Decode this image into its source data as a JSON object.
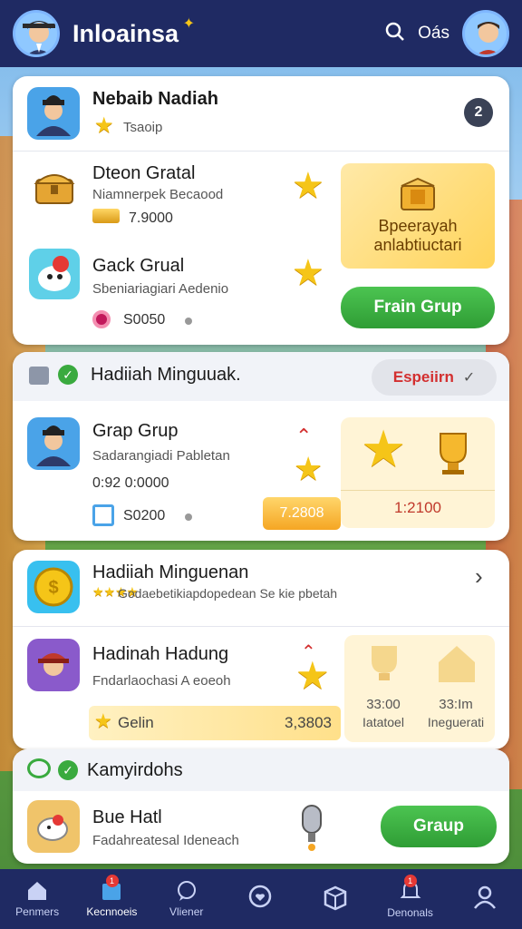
{
  "app": {
    "title": "Inloainsa",
    "top_label": "Oás"
  },
  "card1": {
    "header": {
      "title": "Nebaib Nadiah",
      "subtitle": "Tsaoip",
      "badge": "2"
    },
    "item1": {
      "title": "Dteon Gratal",
      "subtitle": "Niamnerpek Becaood",
      "value": "7.9000"
    },
    "item2": {
      "title": "Gack Grual",
      "subtitle": "Sbeniariagiari Aedenio",
      "value": "S0050"
    },
    "promo_line1": "Bpeerayah",
    "promo_line2": "anlabtiuctari",
    "button": "Frain Grup"
  },
  "card2": {
    "header": {
      "title": "Hadiiah Minguuak.",
      "dropdown": "Espeiirn"
    },
    "item": {
      "title": "Grap Grup",
      "subtitle": "Sadarangiadi Pabletan",
      "code": "0:92 0:0000",
      "value": "S0200"
    },
    "orange_tag": "7.2808",
    "yellow_value": "1:2100"
  },
  "card3": {
    "item1": {
      "title": "Hadiiah Minguenan",
      "subtitle": "Godaebetikiapdopedean Se kie pbetah"
    },
    "item2": {
      "title": "Hadinah Hadung",
      "subtitle": "Fndarlaochasi A eoeoh"
    },
    "gelin_label": "Gelin",
    "gelin_value": "3,3803",
    "prize1_value": "33:00",
    "prize1_label": "Iatatoel",
    "prize2_value": "33:Im",
    "prize2_label": "Ineguerati"
  },
  "card4": {
    "header": "Kamyirdohs",
    "item": {
      "title": "Bue Hatl",
      "subtitle": "Fadahreatesal Ideneach",
      "button": "Graup"
    }
  },
  "tabs": [
    {
      "label": "Penmers",
      "icon": "home-icon"
    },
    {
      "label": "Kecnnoeis",
      "icon": "store-icon",
      "badge": "1"
    },
    {
      "label": "Vliener",
      "icon": "chat-icon"
    },
    {
      "label": "",
      "icon": "search-heart-icon"
    },
    {
      "label": "",
      "icon": "box-icon"
    },
    {
      "label": "Denonals",
      "icon": "bell-icon",
      "badge": "1"
    },
    {
      "label": "",
      "icon": "profile-icon"
    }
  ],
  "colors": {
    "nav_bg": "#1f2a63",
    "accent_green": "#3aaa3f",
    "gold": "#f5c518",
    "dropdown_text": "#d32f2f"
  }
}
